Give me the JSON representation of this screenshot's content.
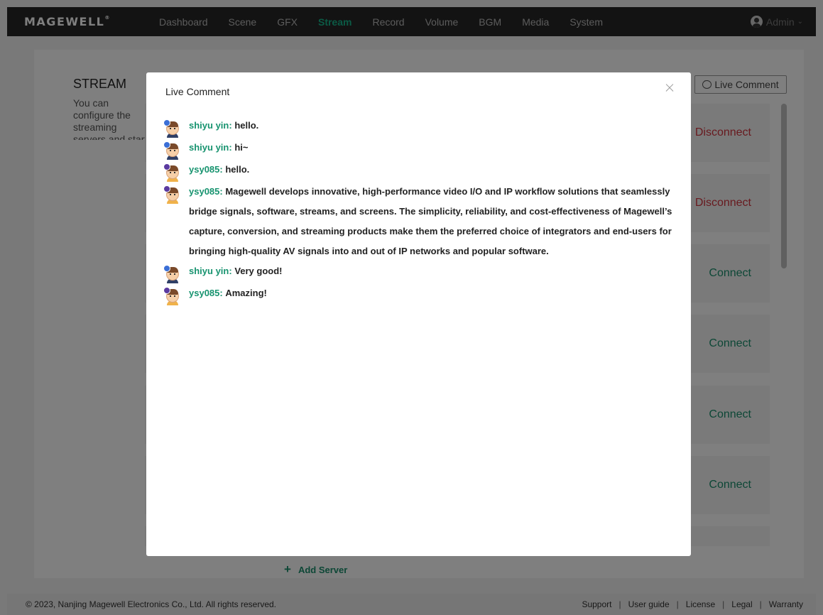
{
  "header": {
    "logo": "MAGEWELL",
    "logo_mark": "®",
    "nav": [
      "Dashboard",
      "Scene",
      "GFX",
      "Stream",
      "Record",
      "Volume",
      "BGM",
      "Media",
      "System"
    ],
    "active_nav": "Stream",
    "user": "Admin",
    "accent_color": "#17b48a"
  },
  "page": {
    "title": "STREAM",
    "description": "You can configure the streaming servers and start or stop streaming at the same time.",
    "live_comment_button": "Live Comment",
    "rows": [
      {
        "action": "Disconnect"
      },
      {
        "action": "Disconnect"
      },
      {
        "action": "Connect"
      },
      {
        "action": "Connect"
      },
      {
        "action": "Connect"
      },
      {
        "action": "Connect"
      }
    ],
    "add_server": "Add Server",
    "connect_color": "#1a8f6d",
    "disconnect_color": "#d0343f"
  },
  "modal": {
    "title": "Live Comment",
    "messages": [
      {
        "author": "shiyu yin:",
        "text": "hello.",
        "avatar": "blue-badge-avatar"
      },
      {
        "author": "shiyu yin:",
        "text": "hi~",
        "avatar": "blue-badge-avatar"
      },
      {
        "author": "ysy085:",
        "text": "hello.",
        "avatar": "purple-badge-avatar"
      },
      {
        "author": "ysy085:",
        "text": "Magewell develops innovative, high-performance video I/O and IP workflow solutions that seamlessly bridge signals, software, streams, and screens. The simplicity, reliability, and cost-effectiveness of Magewell’s capture, conversion, and streaming products make them the preferred choice of integrators and end-users for bringing high-quality AV signals into and out of IP networks and popular software.",
        "avatar": "purple-badge-avatar"
      },
      {
        "author": "shiyu yin:",
        "text": "Very good!",
        "avatar": "blue-badge-avatar"
      },
      {
        "author": "ysy085:",
        "text": "Amazing!",
        "avatar": "purple-badge-avatar"
      }
    ]
  },
  "footer": {
    "copyright": "© 2023, Nanjing Magewell Electronics Co., Ltd. All rights reserved.",
    "links": [
      "Support",
      "User guide",
      "License",
      "Legal",
      "Warranty"
    ]
  }
}
